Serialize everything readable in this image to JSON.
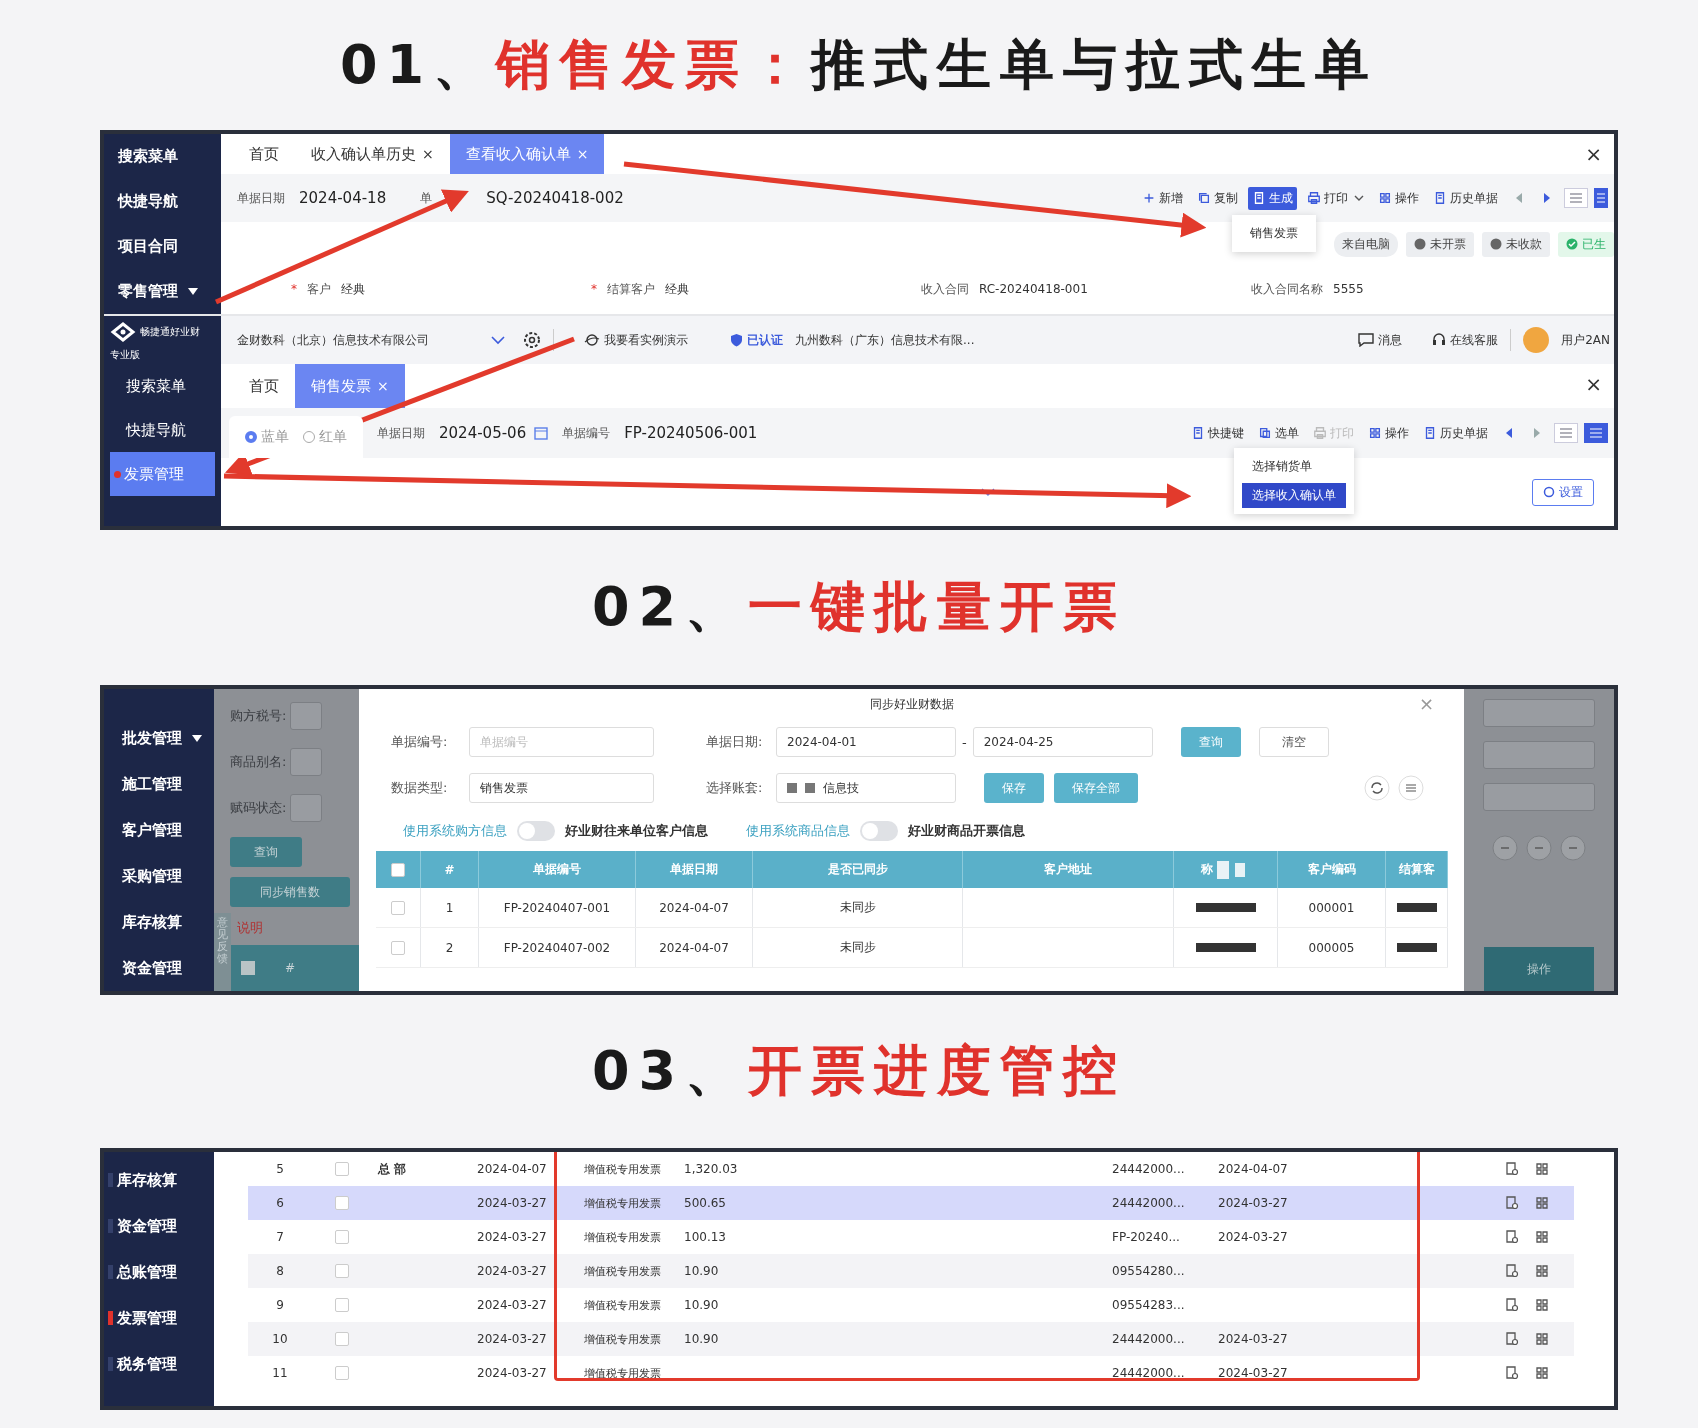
{
  "section_1": {
    "heading": {
      "number": "01、",
      "highlight": "销售发票：",
      "rest": "推式生单与拉式生单"
    },
    "upper_screen": {
      "sidebar": [
        {
          "label": "搜索菜单",
          "expandable": false
        },
        {
          "label": "快捷导航",
          "expandable": false
        },
        {
          "label": "项目合同",
          "expandable": false
        },
        {
          "label": "零售管理",
          "expandable": true
        }
      ],
      "tabs": [
        {
          "label": "首页",
          "selected": false
        },
        {
          "label": "收入确认单历史",
          "close_mark": "×",
          "selected": false
        },
        {
          "label": "查看收入确认单",
          "close_mark": "×",
          "selected": true
        }
      ],
      "close": "×",
      "date_label": "单据日期",
      "date": "2024-04-18",
      "number_label": "单",
      "number": "SQ-20240418-002",
      "toolbar": [
        {
          "kind": "add",
          "label": "新增",
          "selected": false,
          "caret": false
        },
        {
          "kind": "copy",
          "label": "复制",
          "selected": false,
          "caret": false
        },
        {
          "kind": "generate",
          "label": "生成",
          "selected": true,
          "caret": false
        },
        {
          "kind": "print",
          "label": "打印",
          "selected": false,
          "caret": true
        },
        {
          "kind": "operate",
          "label": "操作",
          "selected": false,
          "caret": false
        },
        {
          "kind": "history",
          "label": "历史单据",
          "selected": false,
          "caret": false
        }
      ],
      "menu": [
        {
          "label": "销售发票",
          "selected": false
        }
      ],
      "status_tags": [
        {
          "label": "来自电脑",
          "kind": "source"
        },
        {
          "label": "未开票",
          "kind": "pending"
        },
        {
          "label": "未收款",
          "kind": "pending"
        },
        {
          "label": "已生",
          "kind": "done"
        }
      ],
      "fields": [
        {
          "mark": "*",
          "label": "客户",
          "value": "经典"
        },
        {
          "mark": "*",
          "label": "结算客户",
          "value": "经典"
        },
        {
          "label": "收入合同",
          "value": "RC-20240418-001"
        },
        {
          "label": "收入合同名称",
          "value": "5555"
        }
      ]
    },
    "lower_screen": {
      "brand": {
        "name": "畅捷通好业财",
        "edition": "专业版"
      },
      "sidebar": [
        {
          "label": "搜索菜单",
          "selected": false
        },
        {
          "label": "快捷导航",
          "selected": false
        },
        {
          "label": "发票管理",
          "selected": true
        }
      ],
      "company": "金财数科（北京）信息技术有限公司",
      "demo": "我要看实例演示",
      "verified": "已认证",
      "org": "九州数科（广东）信息技术有限...",
      "message": "消息",
      "service": "在线客服",
      "user": "用户2AN",
      "tabs": [
        {
          "label": "首页",
          "selected": false
        },
        {
          "label": "销售发票",
          "close_mark": "×",
          "selected": true
        }
      ],
      "close": "×",
      "bill_types": [
        {
          "label": "蓝单",
          "selected": true
        },
        {
          "label": "红单",
          "selected": false
        }
      ],
      "date_label": "单据日期",
      "date": "2024-05-06",
      "number_label": "单据编号",
      "number": "FP-20240506-001",
      "toolbar": [
        {
          "kind": "shortcut",
          "label": "快捷键",
          "disabled": false
        },
        {
          "kind": "select",
          "label": "选单",
          "disabled": false
        },
        {
          "kind": "print",
          "label": "打印",
          "disabled": true
        },
        {
          "kind": "operate",
          "label": "操作",
          "disabled": false
        },
        {
          "kind": "history",
          "label": "历史单据",
          "disabled": false
        }
      ],
      "menu": [
        {
          "label": "选择销货单",
          "selected": false
        },
        {
          "label": "选择收入确认单",
          "selected": true
        }
      ],
      "settings": "设置"
    }
  },
  "section_2": {
    "heading": {
      "number": "02、",
      "highlight": "一键批量开票"
    },
    "sidebar": [
      {
        "label": "批发管理",
        "expandable": true
      },
      {
        "label": "施工管理",
        "expandable": false
      },
      {
        "label": "客户管理",
        "expandable": false
      },
      {
        "label": "采购管理",
        "expandable": false
      },
      {
        "label": "库存核算",
        "expandable": false
      },
      {
        "label": "资金管理",
        "expandable": false
      }
    ],
    "background_form": {
      "labels": [
        "购方税号:",
        "商品别名:",
        "赋码状态:"
      ],
      "query": "查询",
      "sync": "同步销售数",
      "help": "说明",
      "feedback": "意见反馈",
      "hash": "#",
      "action": "操作"
    },
    "dialog": {
      "title": "同步好业财数据",
      "close": "×",
      "number_label": "单据编号:",
      "number_placeholder": "单据编号",
      "date_label": "单据日期:",
      "date_from": "2024-04-01",
      "separator": "-",
      "date_to": "2024-04-25",
      "query": "查询",
      "clear": "清空",
      "type_label": "数据类型:",
      "type_value": "销售发票",
      "book_label": "选择账套:",
      "book_value": "信息技",
      "save": "保存",
      "save_all": "保存全部",
      "toggles": [
        {
          "link": "使用系统购方信息",
          "on": false,
          "label": "好业财往来单位客户信息"
        },
        {
          "link": "使用系统商品信息",
          "on": false,
          "label": "好业财商品开票信息"
        }
      ],
      "columns": [
        "#",
        "单据编号",
        "单据日期",
        "是否已同步",
        "客户地址",
        "称",
        "客户编码",
        "结算客"
      ],
      "select_all_checked": false,
      "rows": [
        {
          "checked": false,
          "index": "1",
          "number": "FP-20240407-001",
          "date": "2024-04-07",
          "synced": "未同步",
          "code": "000001"
        },
        {
          "checked": false,
          "index": "2",
          "number": "FP-20240407-002",
          "date": "2024-04-07",
          "synced": "未同步",
          "code": "000005"
        }
      ]
    }
  },
  "section_3": {
    "heading": {
      "number": "03、",
      "highlight": "开票进度管控"
    },
    "sidebar": [
      {
        "label": "库存核算",
        "selected": false
      },
      {
        "label": "资金管理",
        "selected": false
      },
      {
        "label": "总账管理",
        "selected": false
      },
      {
        "label": "发票管理",
        "selected": true
      },
      {
        "label": "税务管理",
        "selected": false
      }
    ],
    "rows": [
      {
        "index": "5",
        "checked": false,
        "selected": false,
        "org": "总 部",
        "date": "2024-04-07",
        "type": "增值税专用发票",
        "amount": "1,320.03",
        "invoice_no": "24442000...",
        "invoice_date": "2024-04-07"
      },
      {
        "index": "6",
        "checked": false,
        "selected": true,
        "date": "2024-03-27",
        "type": "增值税专用发票",
        "amount": "500.65",
        "invoice_no": "24442000...",
        "invoice_date": "2024-03-27"
      },
      {
        "index": "7",
        "checked": false,
        "selected": false,
        "date": "2024-03-27",
        "type": "增值税专用发票",
        "amount": "100.13",
        "invoice_no": "FP-20240...",
        "invoice_date": "2024-03-27"
      },
      {
        "index": "8",
        "checked": false,
        "selected": false,
        "date": "2024-03-27",
        "type": "增值税专用发票",
        "amount": "10.90",
        "invoice_no": "09554280..."
      },
      {
        "index": "9",
        "checked": false,
        "selected": false,
        "date": "2024-03-27",
        "type": "增值税专用发票",
        "amount": "10.90",
        "invoice_no": "09554283..."
      },
      {
        "index": "10",
        "checked": false,
        "selected": false,
        "date": "2024-03-27",
        "type": "增值税专用发票",
        "amount": "10.90",
        "invoice_no": "24442000...",
        "invoice_date": "2024-03-27"
      },
      {
        "index": "11",
        "checked": false,
        "selected": false,
        "date": "2024-03-27",
        "type": "增值税专用发票",
        "invoice_no": "24442000...",
        "invoice_date": "2024-03-27"
      }
    ]
  }
}
